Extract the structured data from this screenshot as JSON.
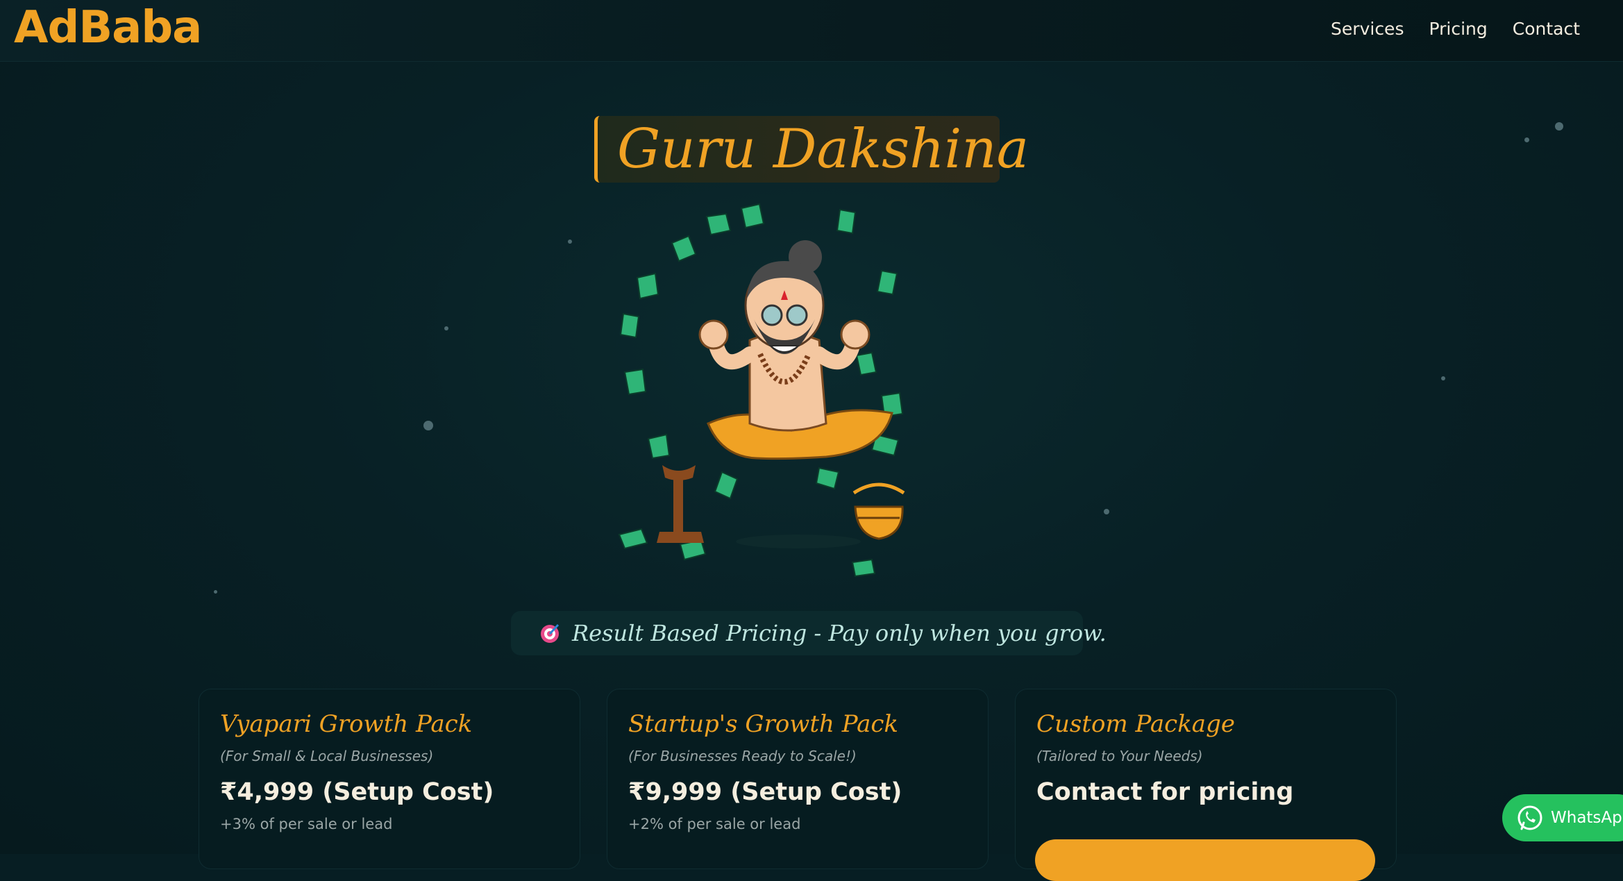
{
  "header": {
    "logo": "AdBaba",
    "nav": [
      "Services",
      "Pricing",
      "Contact"
    ]
  },
  "hero": {
    "title": "Guru Dakshina",
    "illustration": "guru-money-illustration",
    "tagline_icon": "target-icon",
    "tagline": "Result Based Pricing - Pay only when you grow."
  },
  "cards": [
    {
      "title": "Vyapari Growth Pack",
      "subtitle": "(For Small & Local Businesses)",
      "price": "₹4,999 (Setup Cost)",
      "note": "+3% of per sale or lead"
    },
    {
      "title": "Startup's Growth Pack",
      "subtitle": "(For Businesses Ready to Scale!)",
      "price": "₹9,999 (Setup Cost)",
      "note": "+2% of per sale or lead"
    },
    {
      "title": "Custom Package",
      "subtitle": "(Tailored to Your Needs)",
      "price": "Contact for pricing",
      "note": ""
    }
  ],
  "whatsapp": {
    "label": "WhatsApp",
    "icon": "whatsapp-icon"
  },
  "colors": {
    "background": "#071e23",
    "accent": "#f0a224",
    "whatsapp": "#25c15e",
    "money": "#2fb577"
  }
}
